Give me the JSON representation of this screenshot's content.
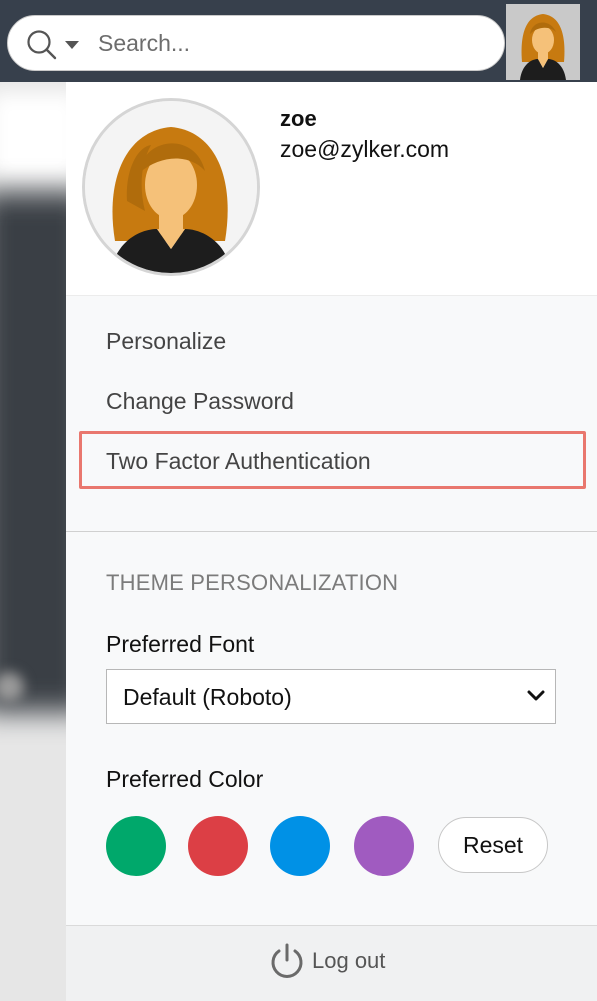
{
  "search": {
    "placeholder": "Search...",
    "icon": "search-icon",
    "dropdown_icon": "chevron-down-icon"
  },
  "user": {
    "name": "zoe",
    "email": "zoe@zylker.com",
    "avatar_icon": "user-avatar"
  },
  "menu": {
    "items": [
      {
        "label": "Personalize"
      },
      {
        "label": "Change Password"
      },
      {
        "label": "Two Factor Authentication",
        "highlighted": true
      }
    ],
    "highlight_color": "#e9776e"
  },
  "theme": {
    "heading": "THEME PERSONALIZATION",
    "font_label": "Preferred Font",
    "font_selected": "Default (Roboto)",
    "color_label": "Preferred Color",
    "colors": [
      "#00a86b",
      "#dc3f45",
      "#0091e6",
      "#a05bc0"
    ],
    "reset_label": "Reset"
  },
  "footer": {
    "logout_label": "Log out",
    "logout_icon": "power-icon"
  }
}
